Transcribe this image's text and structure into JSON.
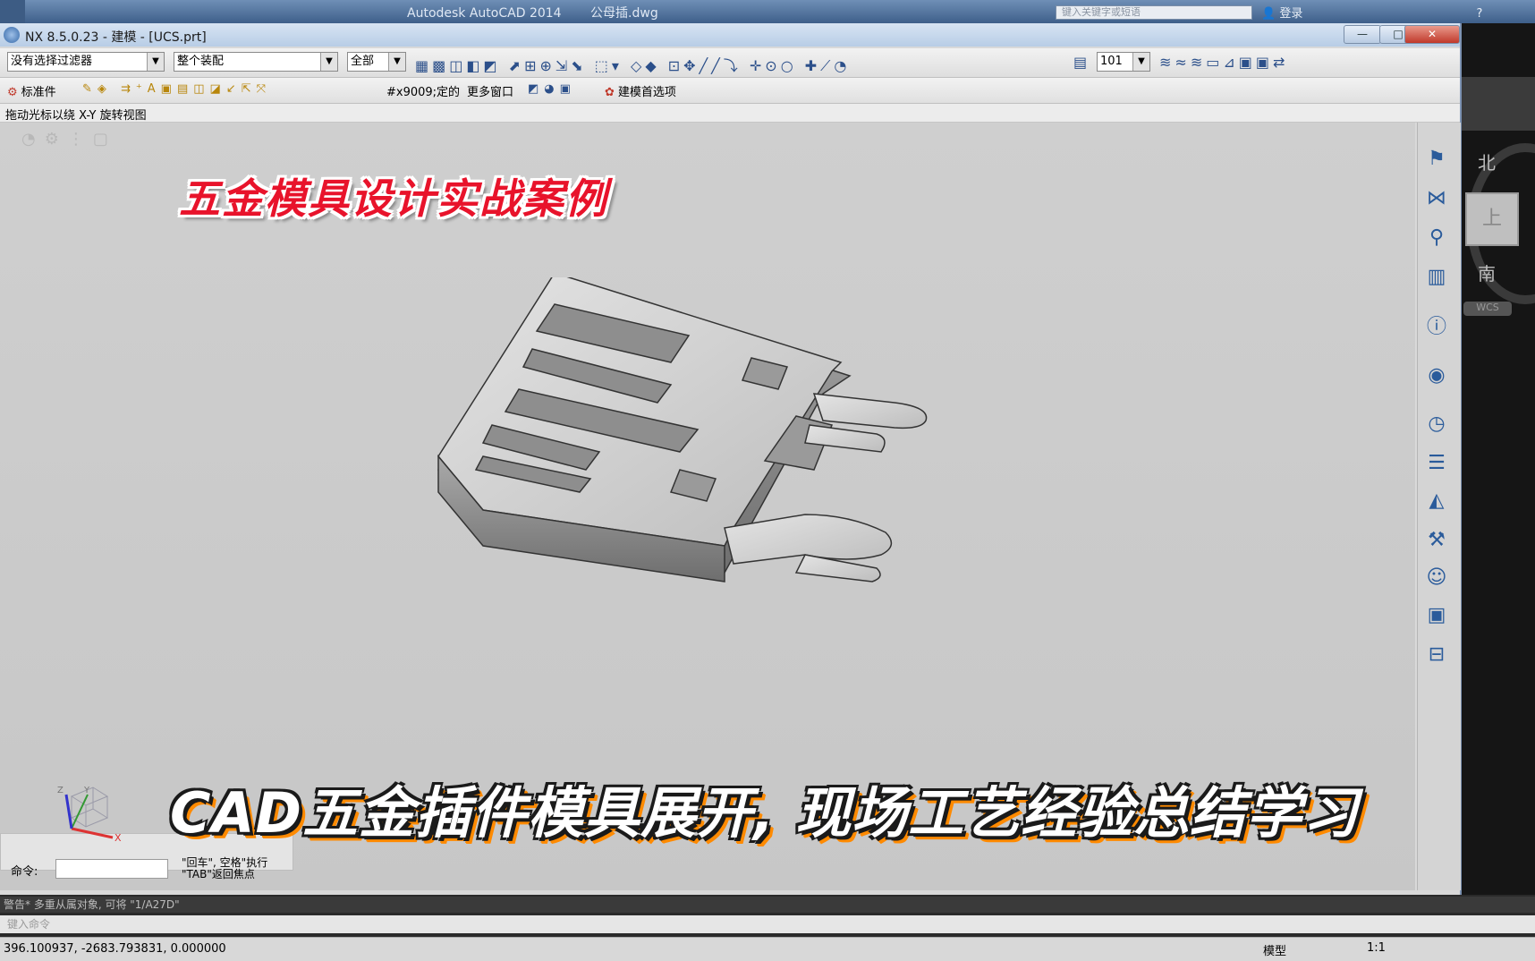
{
  "autocad": {
    "title_app": "Autodesk AutoCAD 2014",
    "title_file": "公母插.dwg",
    "search_placeholder": "键入关键字或短语",
    "sign_in": "登录",
    "viewcube": {
      "north": "北",
      "south": "南",
      "top": "上",
      "wcs": "WCS"
    },
    "command_history": "警告* 多重从属对象, 可将 \"1/A27D\"",
    "command_prompt": "键入命令",
    "coordinates": "396.100937, -2683.793831, 0.000000",
    "model_tab": "模型",
    "scale": "1:1"
  },
  "nx": {
    "title": "NX 8.5.0.23 - 建模 - [UCS.prt]",
    "window_buttons": {
      "minimize": "—",
      "maximize": "□",
      "close": "✕"
    },
    "toolbar1": {
      "selection_filter": "没有选择过滤器",
      "assembly_scope": "整个装配",
      "type_filter": "全部",
      "layer_value": "101"
    },
    "toolbar2": {
      "standard_parts": "标准件",
      "symbol_label": "#x9009;定的",
      "more_windows": "更多窗口",
      "modeling_prefs": "建模首选项"
    },
    "cue_line": "拖动光标以绕 X-Y 旋转视图",
    "command": {
      "label": "命令:",
      "hint_line1": "\"回车\", 空格\"执行",
      "hint_line2": "\"TAB\"返回焦点"
    },
    "triad": {
      "x": "X",
      "y": "Y",
      "z": "Z"
    }
  },
  "overlay": {
    "caption_top": "五金模具设计实战案例",
    "caption_bottom": "CAD五金插件模具展开, 现场工艺经验总结学习"
  }
}
